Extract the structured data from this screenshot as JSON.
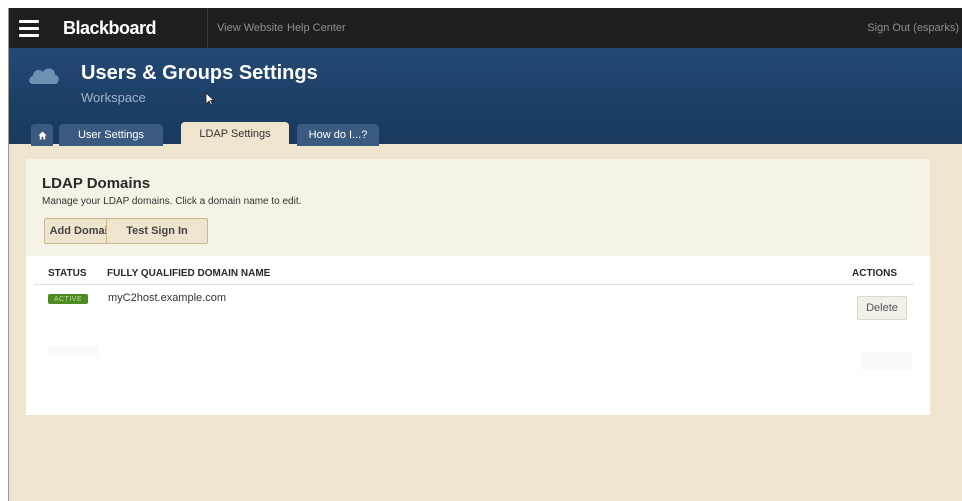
{
  "topbar": {
    "logo": "Blackboard",
    "links": [
      "View Website",
      "Help Center"
    ],
    "signout": "Sign Out (esparks)"
  },
  "header": {
    "title": "Users & Groups Settings",
    "subtitle": "Workspace",
    "tabs": [
      {
        "label": ""
      },
      {
        "label": "User Settings"
      },
      {
        "label": "LDAP Settings"
      },
      {
        "label": "How do I...?"
      }
    ]
  },
  "panel": {
    "title": "LDAP Domains",
    "description": "Manage your LDAP domains. Click a domain name to edit.",
    "buttons": {
      "add": "Add Domain",
      "test": "Test Sign In"
    },
    "table": {
      "columns": [
        "STATUS",
        "FULLY QUALIFIED DOMAIN NAME",
        "ACTIONS"
      ],
      "rows": [
        {
          "status": "ACTIVE",
          "domain": "myC2host.example.com",
          "action": "Delete"
        }
      ]
    }
  },
  "colors": {
    "topbar": "#1f1f1f",
    "header": "#1d3f66",
    "page_bg": "#efe5cf",
    "active_badge": "#4e8a22"
  }
}
